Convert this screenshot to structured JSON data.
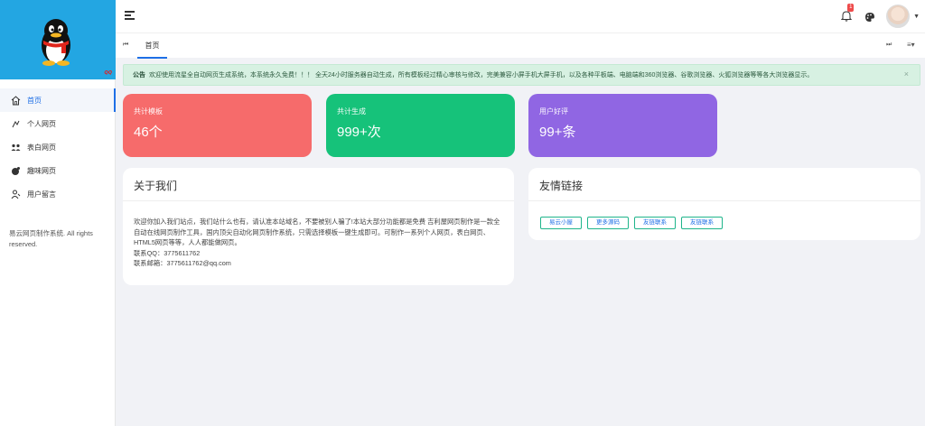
{
  "sidebar": {
    "logo_text": "QQ",
    "items": [
      {
        "label": "首页",
        "icon": "home-icon",
        "active": true
      },
      {
        "label": "个人网页",
        "icon": "person-icon",
        "active": false
      },
      {
        "label": "表白网页",
        "icon": "heart-users-icon",
        "active": false
      },
      {
        "label": "趣味网页",
        "icon": "fun-icon",
        "active": false
      },
      {
        "label": "用户留言",
        "icon": "message-icon",
        "active": false
      }
    ],
    "footer": "易云网页制作系统. All rights reserved."
  },
  "header": {
    "notification_count": "1",
    "menu_icon": "hamburger-icon",
    "bell_icon": "bell-icon",
    "theme_icon": "palette-icon"
  },
  "tabs": {
    "home_label": "首页"
  },
  "notice": {
    "title": "公告",
    "text": "欢迎使用流星全自动网页生成系统，本系统永久免费！！！ 全天24小时服务器自动生成，所有模板经过精心审核与修改，完美兼容小屏手机大屏手机，以及各种平板端、电脑端和360浏览器、谷歌浏览器、火狐浏览器等等各大浏览器显示。",
    "close": "×"
  },
  "stats": [
    {
      "label": "共计模板",
      "value": "46个",
      "color": "#f66b6b"
    },
    {
      "label": "共计生成",
      "value": "999+次",
      "color": "#16c27a"
    },
    {
      "label": "用户好评",
      "value": "99+条",
      "color": "#9066e3"
    }
  ],
  "about": {
    "title": "关于我们",
    "line1": "欢迎你加入我们站点，我们站什么也有，请认准本站域名，不要被别人骗了!本站大部分功能都是免费 吉利屋网页制作是一款全自动在线网页制作工具，国内顶尖自动化网页制作系统，只需选择模板一键生成即可。可制作一系列个人网页，表白网页、HTML5网页等等，人人都能做网页。",
    "qq": "联系QQ：3775611762",
    "email": "联系邮箱：3775611762@qq.com"
  },
  "links": {
    "title": "友情链接",
    "items": [
      "易云小屋",
      "更多源码",
      "友链联系",
      "友链联系"
    ]
  }
}
